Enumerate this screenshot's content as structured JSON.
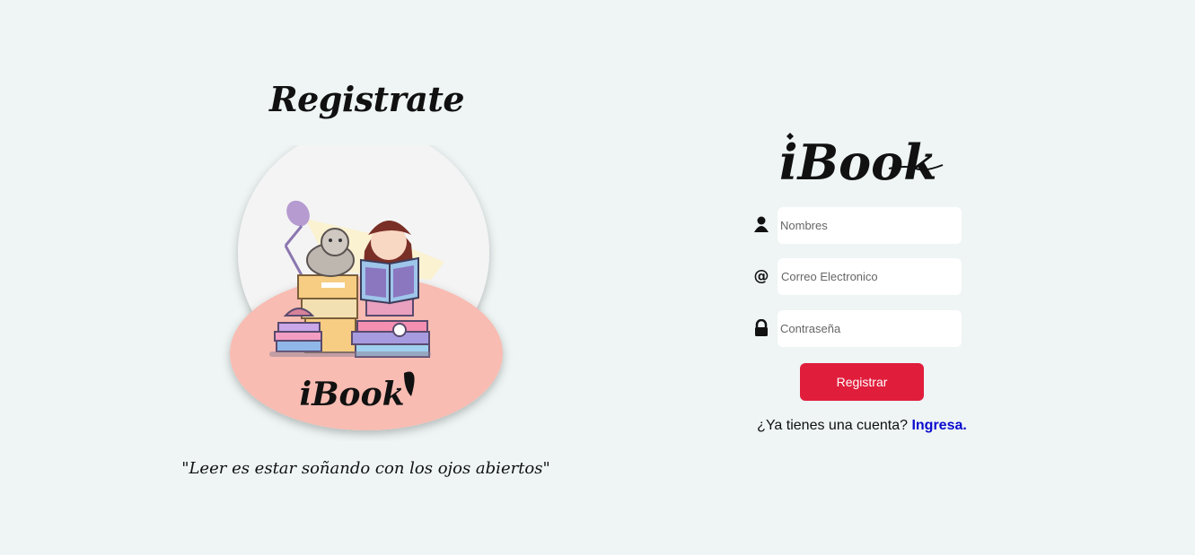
{
  "left_panel": {
    "heading": "Registrate",
    "illustration_logo_text": "iBook",
    "quote": "\"Leer es estar soñando con los ojos abiertos\""
  },
  "logo_text": "iBook",
  "form": {
    "name_placeholder": "Nombres",
    "email_placeholder": "Correo Electronico",
    "password_placeholder": "Contraseña",
    "email_icon_glyph": "@",
    "submit_label": "Registrar",
    "login_prompt": "¿Ya tienes una cuenta?",
    "login_link": "Ingresa."
  },
  "icons": {
    "name": "user-icon",
    "email": "at-sign-icon",
    "password": "lock-icon"
  },
  "colors": {
    "background": "#eef5f4",
    "button": "#e01e3c",
    "link": "#0a0ad0",
    "illustration_base": "#f8bcb2"
  }
}
